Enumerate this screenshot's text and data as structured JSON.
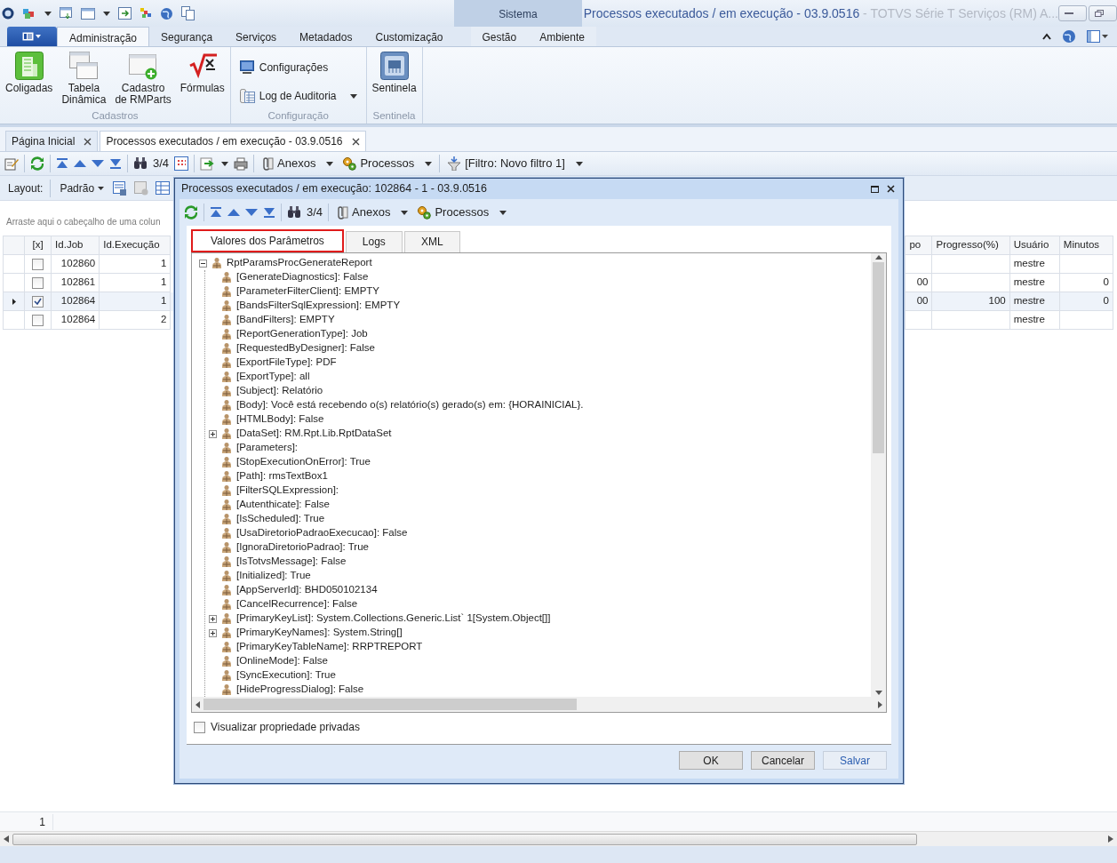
{
  "title_bar": {
    "context_group": "Sistema",
    "title": "Processos executados / em execução - 03.9.0516",
    "subtitle": "- TOTVS Série T Serviços (RM) A..."
  },
  "ribbon_tabs": [
    {
      "label": "Administração",
      "selected": true
    },
    {
      "label": "Segurança",
      "selected": false
    },
    {
      "label": "Serviços",
      "selected": false
    },
    {
      "label": "Metadados",
      "selected": false
    },
    {
      "label": "Customização",
      "selected": false
    },
    {
      "label": "Gestão",
      "selected": false
    },
    {
      "label": "Ambiente",
      "selected": false
    }
  ],
  "ribbon_groups": [
    {
      "label": "Cadastros",
      "items": [
        {
          "label": "Coligadas",
          "kind": "large"
        },
        {
          "label": "Tabela\nDinâmica",
          "kind": "large"
        },
        {
          "label": "Cadastro\nde RMParts",
          "kind": "large"
        },
        {
          "label": "Fórmulas",
          "kind": "large"
        }
      ]
    },
    {
      "label": "Configuração",
      "items": [
        {
          "label": "Configurações",
          "kind": "small",
          "dropdown": false
        },
        {
          "label": "Log de Auditoria",
          "kind": "small",
          "dropdown": true
        }
      ]
    },
    {
      "label": "Sentinela",
      "items": [
        {
          "label": "Sentinela",
          "kind": "large"
        }
      ]
    }
  ],
  "document_tabs": [
    {
      "label": "Página Inicial",
      "selected": false
    },
    {
      "label": "Processos executados / em execução - 03.9.0516",
      "selected": true
    }
  ],
  "toolbar": {
    "counter": "3/4",
    "attachments": "Anexos",
    "processes": "Processos",
    "filter": "[Filtro: Novo filtro 1]"
  },
  "layout_bar": {
    "label": "Layout:",
    "preset": "Padrão"
  },
  "group_panel_hint": "Arraste aqui o cabeçalho de uma colun",
  "grid": {
    "checkbox_column": "[x]",
    "columns": [
      "Id.Job",
      "Id.Execução",
      "po",
      "Progresso(%)",
      "Usuário",
      "Minutos"
    ],
    "rows": [
      {
        "checked": false,
        "current": false,
        "cells": [
          "102860",
          "1",
          "",
          "",
          "mestre",
          ""
        ]
      },
      {
        "checked": false,
        "current": false,
        "cells": [
          "102861",
          "1",
          "00",
          "",
          "mestre",
          "0"
        ]
      },
      {
        "checked": true,
        "current": true,
        "cells": [
          "102864",
          "1",
          "00",
          "100",
          "mestre",
          "0"
        ]
      },
      {
        "checked": false,
        "current": false,
        "cells": [
          "102864",
          "2",
          "",
          "",
          "mestre",
          ""
        ]
      }
    ]
  },
  "footer": {
    "count": "1"
  },
  "dialog": {
    "title": "Processos executados / em execução: 102864 - 1 - 03.9.0516",
    "toolbar": {
      "counter": "3/4",
      "attachments": "Anexos",
      "processes": "Processos"
    },
    "tabs": [
      {
        "label": "Valores dos Parâmetros",
        "selected": true
      },
      {
        "label": "Logs",
        "selected": false
      },
      {
        "label": "XML",
        "selected": false
      }
    ],
    "tree": {
      "label": "RptParamsProcGenerateReport",
      "expanded": true,
      "children": [
        {
          "label": "[GenerateDiagnostics]: False"
        },
        {
          "label": "[ParameterFilterClient]: EMPTY"
        },
        {
          "label": "[BandsFilterSqlExpression]: EMPTY"
        },
        {
          "label": "[BandFilters]: EMPTY"
        },
        {
          "label": "[ReportGenerationType]: Job"
        },
        {
          "label": "[RequestedByDesigner]: False"
        },
        {
          "label": "[ExportFileType]: PDF"
        },
        {
          "label": "[ExportType]: all"
        },
        {
          "label": "[Subject]: Relatório"
        },
        {
          "label": "[Body]: Você está recebendo o(s) relatório(s) gerado(s) em: {HORAINICIAL}."
        },
        {
          "label": "[HTMLBody]: False"
        },
        {
          "label": "[DataSet]: RM.Rpt.Lib.RptDataSet",
          "expanded": false
        },
        {
          "label": "[Parameters]:"
        },
        {
          "label": "[StopExecutionOnError]: True"
        },
        {
          "label": "[Path]: rmsTextBox1"
        },
        {
          "label": "[FilterSQLExpression]:"
        },
        {
          "label": "[Autenthicate]: False"
        },
        {
          "label": "[IsScheduled]: True"
        },
        {
          "label": "[UsaDiretorioPadraoExecucao]: False"
        },
        {
          "label": "[IgnoraDiretorioPadrao]: True"
        },
        {
          "label": "[IsTotvsMessage]: False"
        },
        {
          "label": "[Initialized]: True"
        },
        {
          "label": "[AppServerId]: BHD050102134"
        },
        {
          "label": "[CancelRecurrence]: False"
        },
        {
          "label": "[PrimaryKeyList]: System.Collections.Generic.List` 1[System.Object[]]",
          "expanded": false
        },
        {
          "label": "[PrimaryKeyNames]: System.String[]",
          "expanded": false
        },
        {
          "label": "[PrimaryKeyTableName]: RRPTREPORT"
        },
        {
          "label": "[OnlineMode]: False"
        },
        {
          "label": "[SyncExecution]: True"
        },
        {
          "label": "[HideProgressDialog]: False"
        }
      ]
    },
    "private_properties": {
      "label": "Visualizar propriedade privadas",
      "checked": false
    },
    "buttons": [
      {
        "label": "OK",
        "kind": "normal"
      },
      {
        "label": "Cancelar",
        "kind": "normal"
      },
      {
        "label": "Salvar",
        "kind": "accent"
      }
    ]
  }
}
